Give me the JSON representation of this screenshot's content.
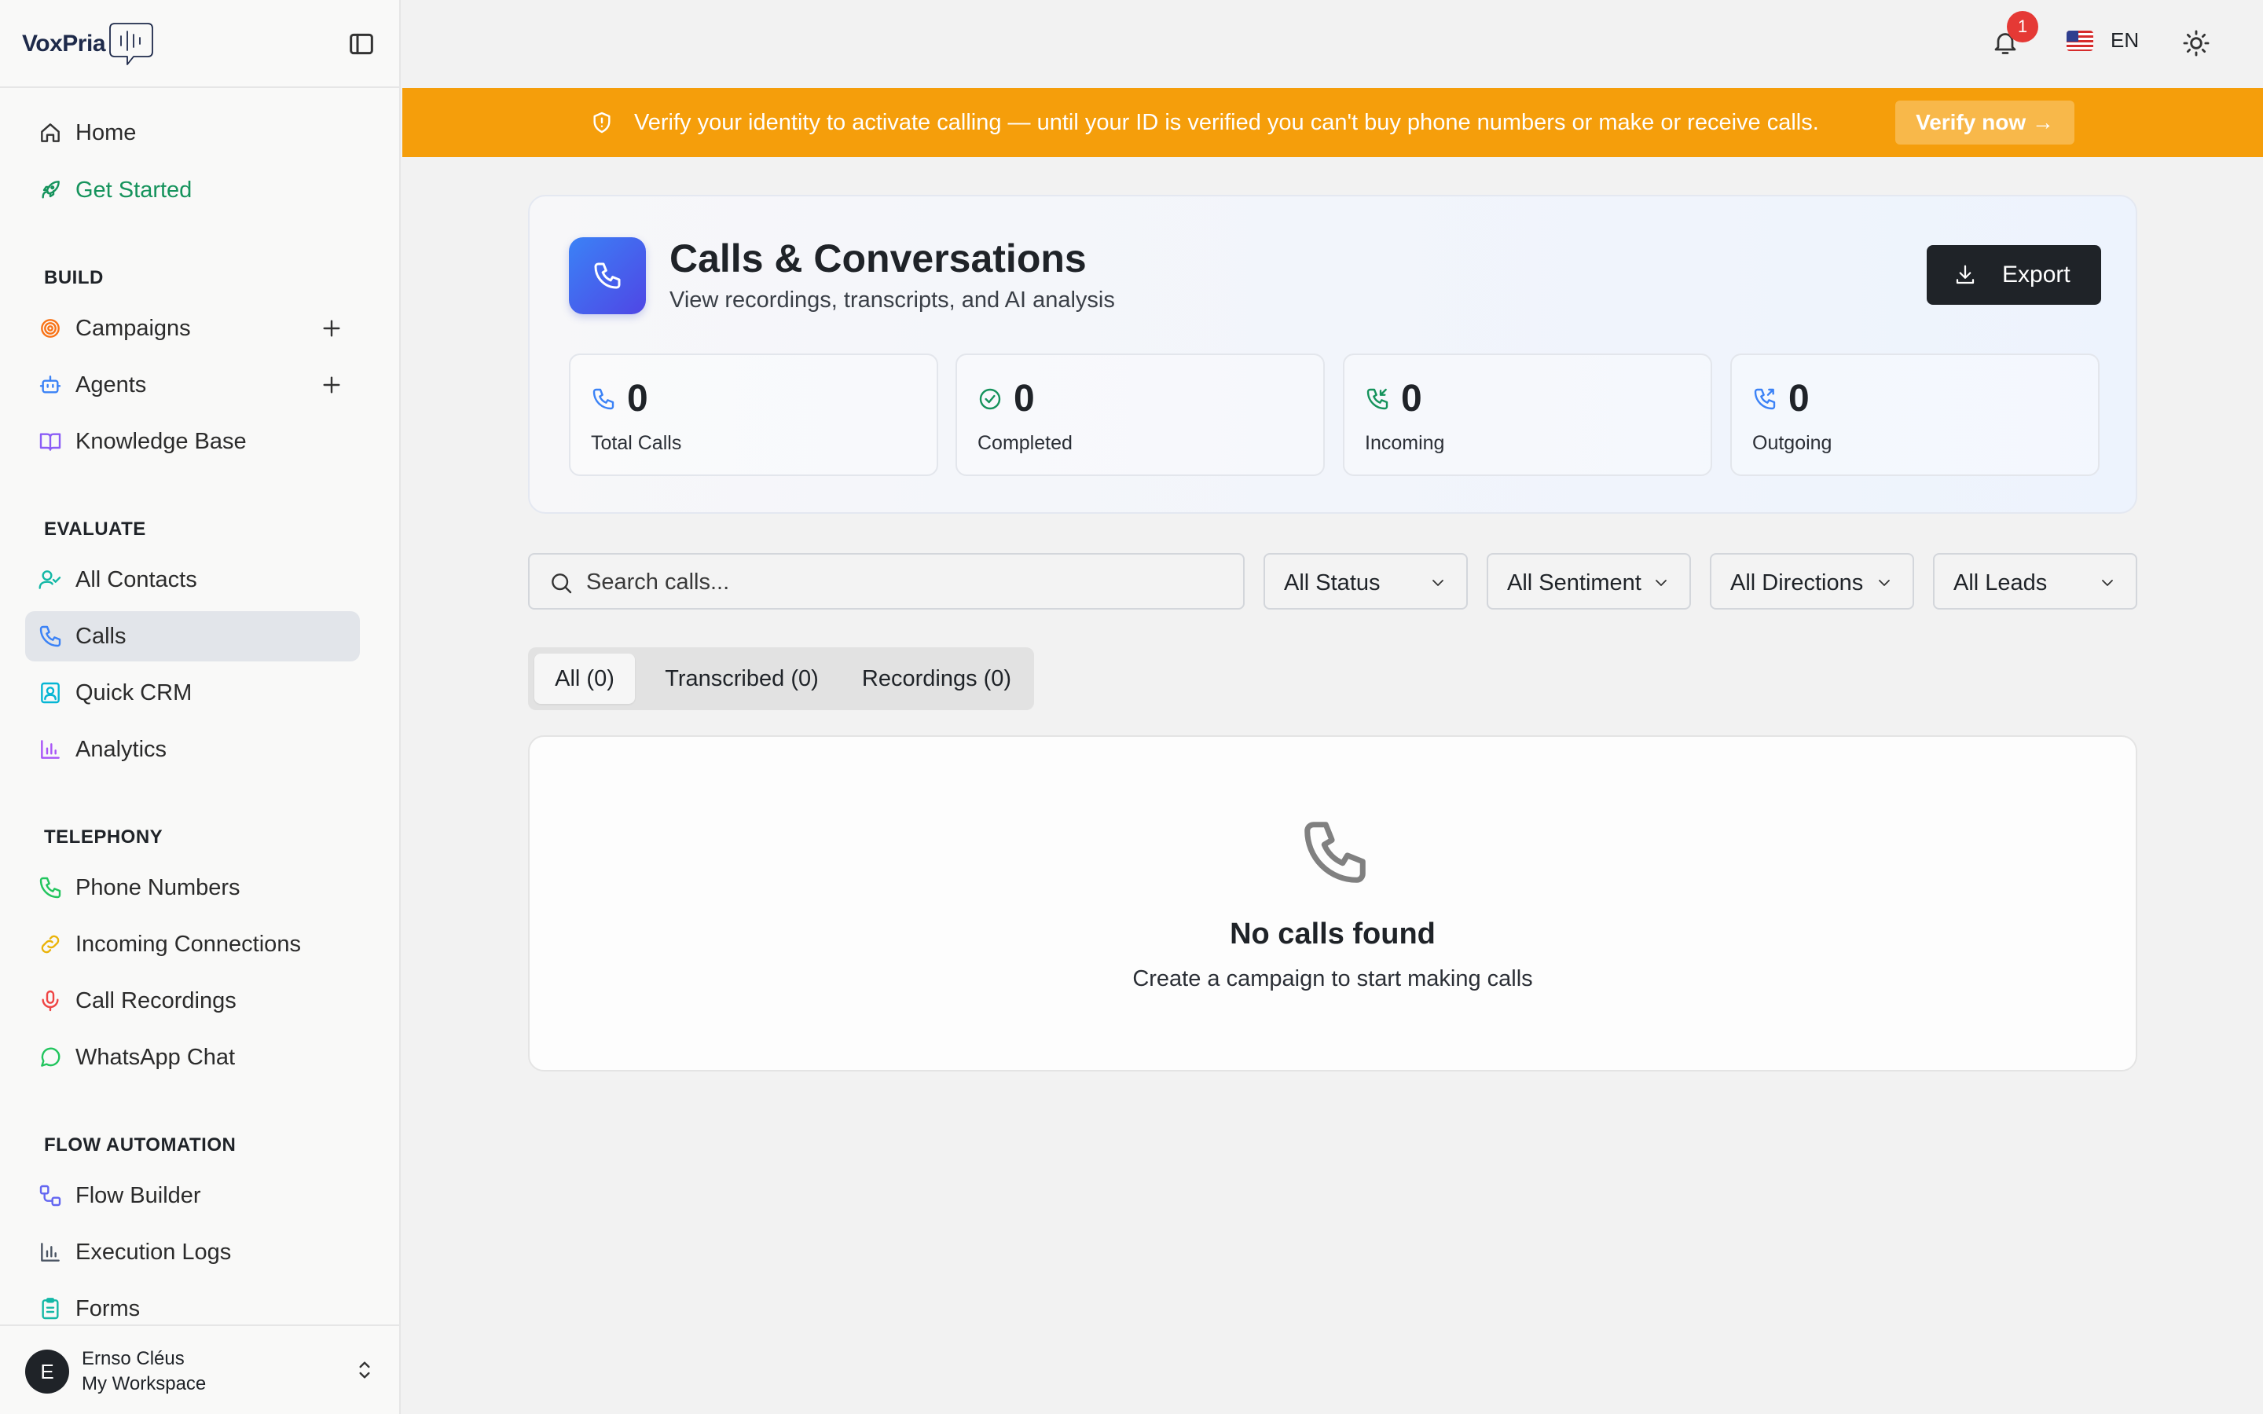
{
  "app": {
    "logo_text": "VoxPria"
  },
  "sidebar": {
    "top_items": [
      {
        "label": "Home",
        "icon": "home-icon"
      },
      {
        "label": "Get Started",
        "icon": "rocket-icon"
      }
    ],
    "sections": {
      "build": "BUILD",
      "evaluate": "EVALUATE",
      "telephony": "TELEPHONY",
      "flow_automation": "FLOW AUTOMATION"
    },
    "build_items": [
      {
        "label": "Campaigns",
        "icon": "target-icon"
      },
      {
        "label": "Agents",
        "icon": "bot-icon"
      },
      {
        "label": "Knowledge Base",
        "icon": "book-icon"
      }
    ],
    "evaluate_items": [
      {
        "label": "All Contacts",
        "icon": "user-check-icon"
      },
      {
        "label": "Calls",
        "icon": "phone-icon"
      },
      {
        "label": "Quick CRM",
        "icon": "contact-card-icon"
      },
      {
        "label": "Analytics",
        "icon": "bar-chart-icon"
      }
    ],
    "telephony_items": [
      {
        "label": "Phone Numbers",
        "icon": "phone-icon"
      },
      {
        "label": "Incoming Connections",
        "icon": "link-icon"
      },
      {
        "label": "Call Recordings",
        "icon": "mic-icon"
      },
      {
        "label": "WhatsApp Chat",
        "icon": "chat-icon"
      }
    ],
    "flow_items": [
      {
        "label": "Flow Builder",
        "icon": "workflow-icon"
      },
      {
        "label": "Execution Logs",
        "icon": "bar-chart-icon"
      },
      {
        "label": "Forms",
        "icon": "clipboard-icon"
      }
    ],
    "user": {
      "initial": "E",
      "name": "Ernso Cléus",
      "workspace": "My Workspace"
    }
  },
  "topbar": {
    "notification_count": "1",
    "language": "EN"
  },
  "banner": {
    "text": "Verify your identity to activate calling — until your ID is verified you can't buy phone numbers or make or receive calls.",
    "button": "Verify now →"
  },
  "header": {
    "title": "Calls & Conversations",
    "subtitle": "View recordings, transcripts, and AI analysis",
    "export_label": "Export",
    "stats": [
      {
        "value": "0",
        "label": "Total Calls"
      },
      {
        "value": "0",
        "label": "Completed"
      },
      {
        "value": "0",
        "label": "Incoming"
      },
      {
        "value": "0",
        "label": "Outgoing"
      }
    ]
  },
  "filters": {
    "search_placeholder": "Search calls...",
    "status": "All Status",
    "sentiment": "All Sentiment",
    "directions": "All Directions",
    "leads": "All Leads"
  },
  "tabs": [
    {
      "label": "All (0)"
    },
    {
      "label": "Transcribed (0)"
    },
    {
      "label": "Recordings (0)"
    }
  ],
  "empty_state": {
    "title": "No calls found",
    "subtitle": "Create a campaign to start making calls"
  },
  "colors": {
    "accent_green": "#15935c",
    "banner_orange": "#f59e0b",
    "primary_dark": "#1f2328",
    "header_icon_blue": "#3b82f6"
  }
}
